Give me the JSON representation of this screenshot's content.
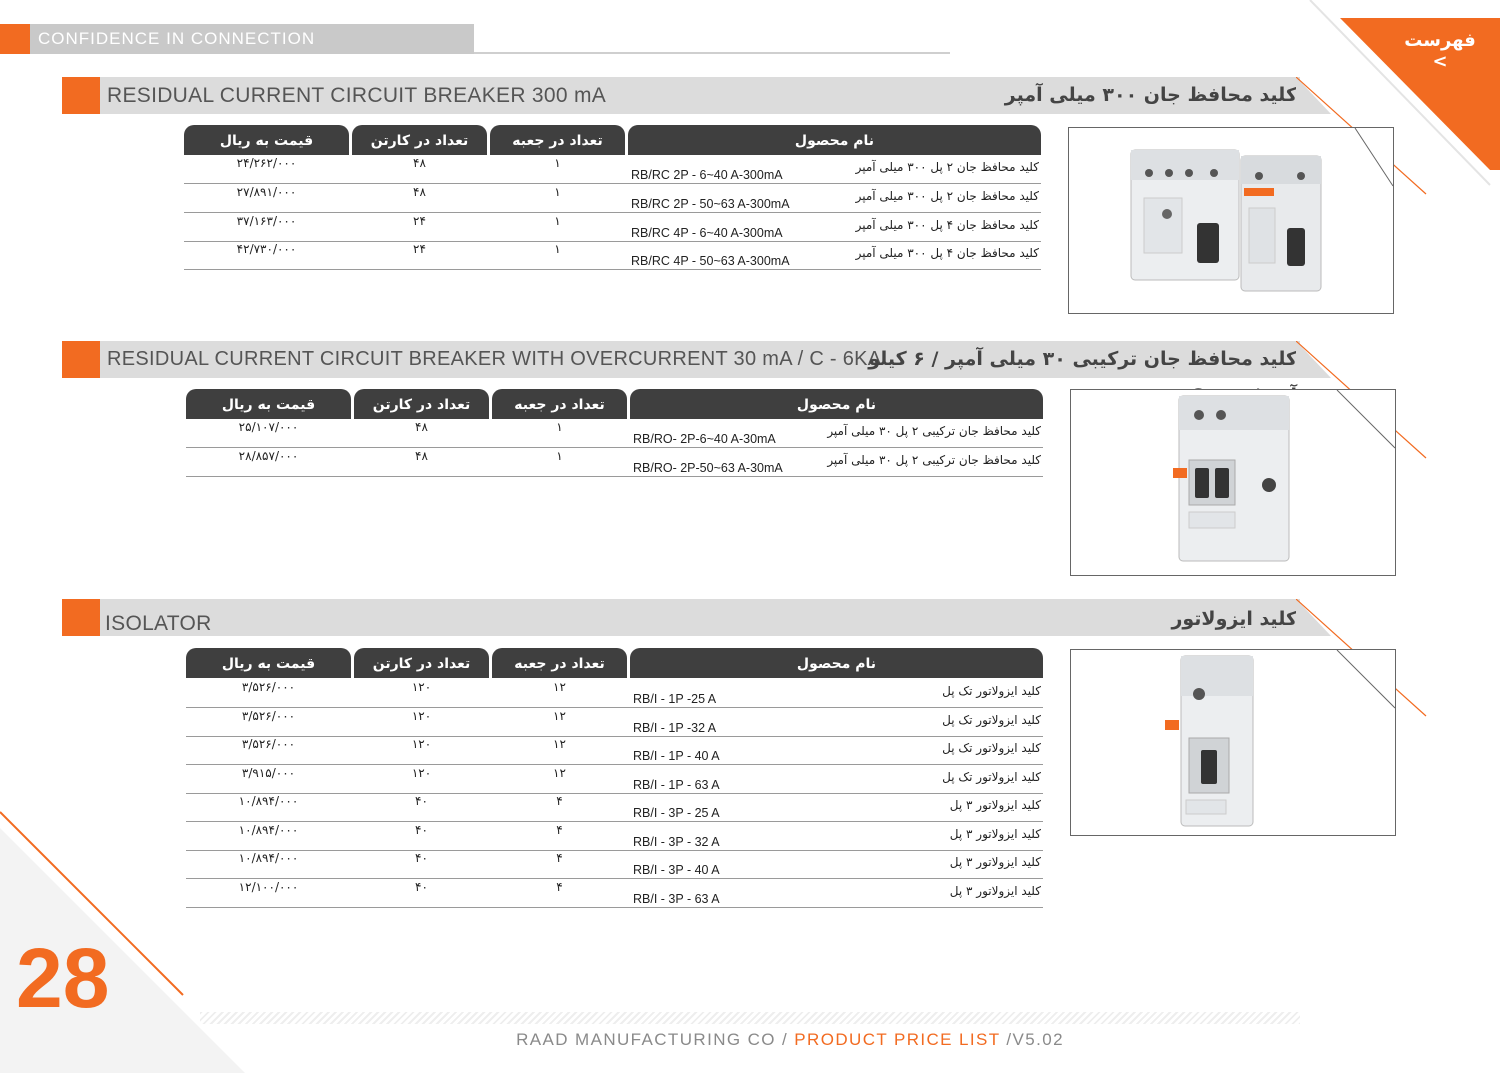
{
  "header": {
    "tagline": "CONFIDENCE IN CONNECTION",
    "index_link": "فهرست >"
  },
  "colors": {
    "accent": "#f26b21",
    "band": "#dcdcdc",
    "table_header": "#3f3f3f"
  },
  "table_headers": {
    "name": "نام محصول",
    "per_box": "تعداد در جعبه",
    "per_carton": "تعداد در کارتن",
    "price": "قیمت به ریال"
  },
  "sections": [
    {
      "title_en": "RESIDUAL CURRENT CIRCUIT BREAKER 300 mA",
      "title_fa": "کلید محافظ جان ۳۰۰ میلی آمپر",
      "rows": [
        {
          "name_fa": "کلید محافظ جان ۲ پل ۳۰۰ میلی آمپر",
          "code": "RB/RC 2P - 6~40 A-300mA",
          "per_box": "۱",
          "per_carton": "۴۸",
          "price": "۲۴/۲۶۲/۰۰۰"
        },
        {
          "name_fa": "کلید محافظ جان ۲ پل ۳۰۰ میلی آمپر",
          "code": "RB/RC 2P - 50~63 A-300mA",
          "per_box": "۱",
          "per_carton": "۴۸",
          "price": "۲۷/۸۹۱/۰۰۰"
        },
        {
          "name_fa": "کلید محافظ جان ۴ پل ۳۰۰ میلی آمپر",
          "code": "RB/RC 4P - 6~40 A-300mA",
          "per_box": "۱",
          "per_carton": "۲۴",
          "price": "۳۷/۱۶۳/۰۰۰"
        },
        {
          "name_fa": "کلید محافظ جان ۴ پل ۳۰۰ میلی آمپر",
          "code": "RB/RC 4P - 50~63 A-300mA",
          "per_box": "۱",
          "per_carton": "۲۴",
          "price": "۴۲/۷۳۰/۰۰۰"
        }
      ]
    },
    {
      "title_en": "RESIDUAL CURRENT CIRCUIT BREAKER WITH OVERCURRENT 30 mA / C - 6KA",
      "title_fa": "کلید محافظ جان ترکیبی ۳۰ میلی آمپر / ۶ کیلو آمپر/ تیپ C",
      "rows": [
        {
          "name_fa": "کلید محافظ جان ترکیبی ۲ پل ۳۰ میلی آمپر",
          "code": "RB/RO- 2P-6~40 A-30mA",
          "per_box": "۱",
          "per_carton": "۴۸",
          "price": "۲۵/۱۰۷/۰۰۰"
        },
        {
          "name_fa": "کلید محافظ جان ترکیبی ۲ پل ۳۰ میلی آمپر",
          "code": "RB/RO- 2P-50~63 A-30mA",
          "per_box": "۱",
          "per_carton": "۴۸",
          "price": "۲۸/۸۵۷/۰۰۰"
        }
      ]
    },
    {
      "title_en": "ISOLATOR",
      "title_fa": "کلید ایزولاتور",
      "rows": [
        {
          "name_fa": "کلید ایزولاتور تک پل",
          "code": "RB/I - 1P -25 A",
          "per_box": "۱۲",
          "per_carton": "۱۲۰",
          "price": "۳/۵۲۶/۰۰۰"
        },
        {
          "name_fa": "کلید ایزولاتور تک پل",
          "code": "RB/I - 1P -32 A",
          "per_box": "۱۲",
          "per_carton": "۱۲۰",
          "price": "۳/۵۲۶/۰۰۰"
        },
        {
          "name_fa": "کلید ایزولاتور تک پل",
          "code": "RB/I - 1P - 40 A",
          "per_box": "۱۲",
          "per_carton": "۱۲۰",
          "price": "۳/۵۲۶/۰۰۰"
        },
        {
          "name_fa": "کلید ایزولاتور تک پل",
          "code": "RB/I - 1P - 63 A",
          "per_box": "۱۲",
          "per_carton": "۱۲۰",
          "price": "۳/۹۱۵/۰۰۰"
        },
        {
          "name_fa": "کلید ایزولاتور ۳ پل",
          "code": "RB/I - 3P - 25 A",
          "per_box": "۴",
          "per_carton": "۴۰",
          "price": "۱۰/۸۹۴/۰۰۰"
        },
        {
          "name_fa": "کلید ایزولاتور ۳ پل",
          "code": "RB/I - 3P - 32 A",
          "per_box": "۴",
          "per_carton": "۴۰",
          "price": "۱۰/۸۹۴/۰۰۰"
        },
        {
          "name_fa": "کلید ایزولاتور ۳ پل",
          "code": "RB/I - 3P - 40 A",
          "per_box": "۴",
          "per_carton": "۴۰",
          "price": "۱۰/۸۹۴/۰۰۰"
        },
        {
          "name_fa": "کلید ایزولاتور ۳ پل",
          "code": "RB/I - 3P - 63 A",
          "per_box": "۴",
          "per_carton": "۴۰",
          "price": "۱۲/۱۰۰/۰۰۰"
        }
      ]
    }
  ],
  "footer": {
    "company": "RAAD MANUFACTURING CO /",
    "doc": "PRODUCT PRICE LIST",
    "version": "/V5.02"
  },
  "page_number": "28"
}
